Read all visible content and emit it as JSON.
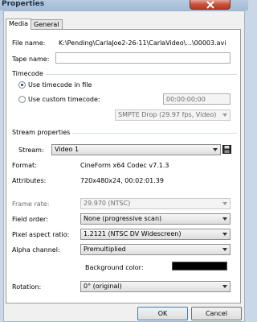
{
  "window": {
    "title": "Properties"
  },
  "tabs": [
    {
      "label": "Media"
    },
    {
      "label": "General"
    }
  ],
  "media": {
    "file_name_label": "File name:",
    "file_name_value": "K:\\Pending\\CarlaJoe2-26-11\\CarlaVideo\\...\\00003.avi",
    "tape_name_label": "Tape name:",
    "tape_name_value": ""
  },
  "timecode": {
    "heading": "Timecode",
    "use_file_label": "Use timecode in file",
    "use_custom_label": "Use custom timecode:",
    "custom_value": "00:00:00;00",
    "format_value": "SMPTE Drop (29.97 fps, Video)",
    "selected": "use_file"
  },
  "stream": {
    "heading": "Stream properties",
    "stream_label": "Stream:",
    "stream_value": "Video 1",
    "format_label": "Format:",
    "format_value": "CineForm x64 Codec v7.1.3",
    "attributes_label": "Attributes:",
    "attributes_value": "720x480x24, 00:02:01.39",
    "frame_rate_label": "Frame rate:",
    "frame_rate_value": "29.970 (NTSC)",
    "field_order_label": "Field order:",
    "field_order_value": "None (progressive scan)",
    "par_label": "Pixel aspect ratio:",
    "par_value": "1.2121 (NTSC DV Widescreen)",
    "alpha_label": "Alpha channel:",
    "alpha_value": "Premultiplied",
    "bg_label": "Background color:",
    "bg_color": "#000000",
    "rotation_label": "Rotation:",
    "rotation_value": "0° (original)"
  },
  "buttons": {
    "ok": "OK",
    "cancel": "Cancel"
  }
}
